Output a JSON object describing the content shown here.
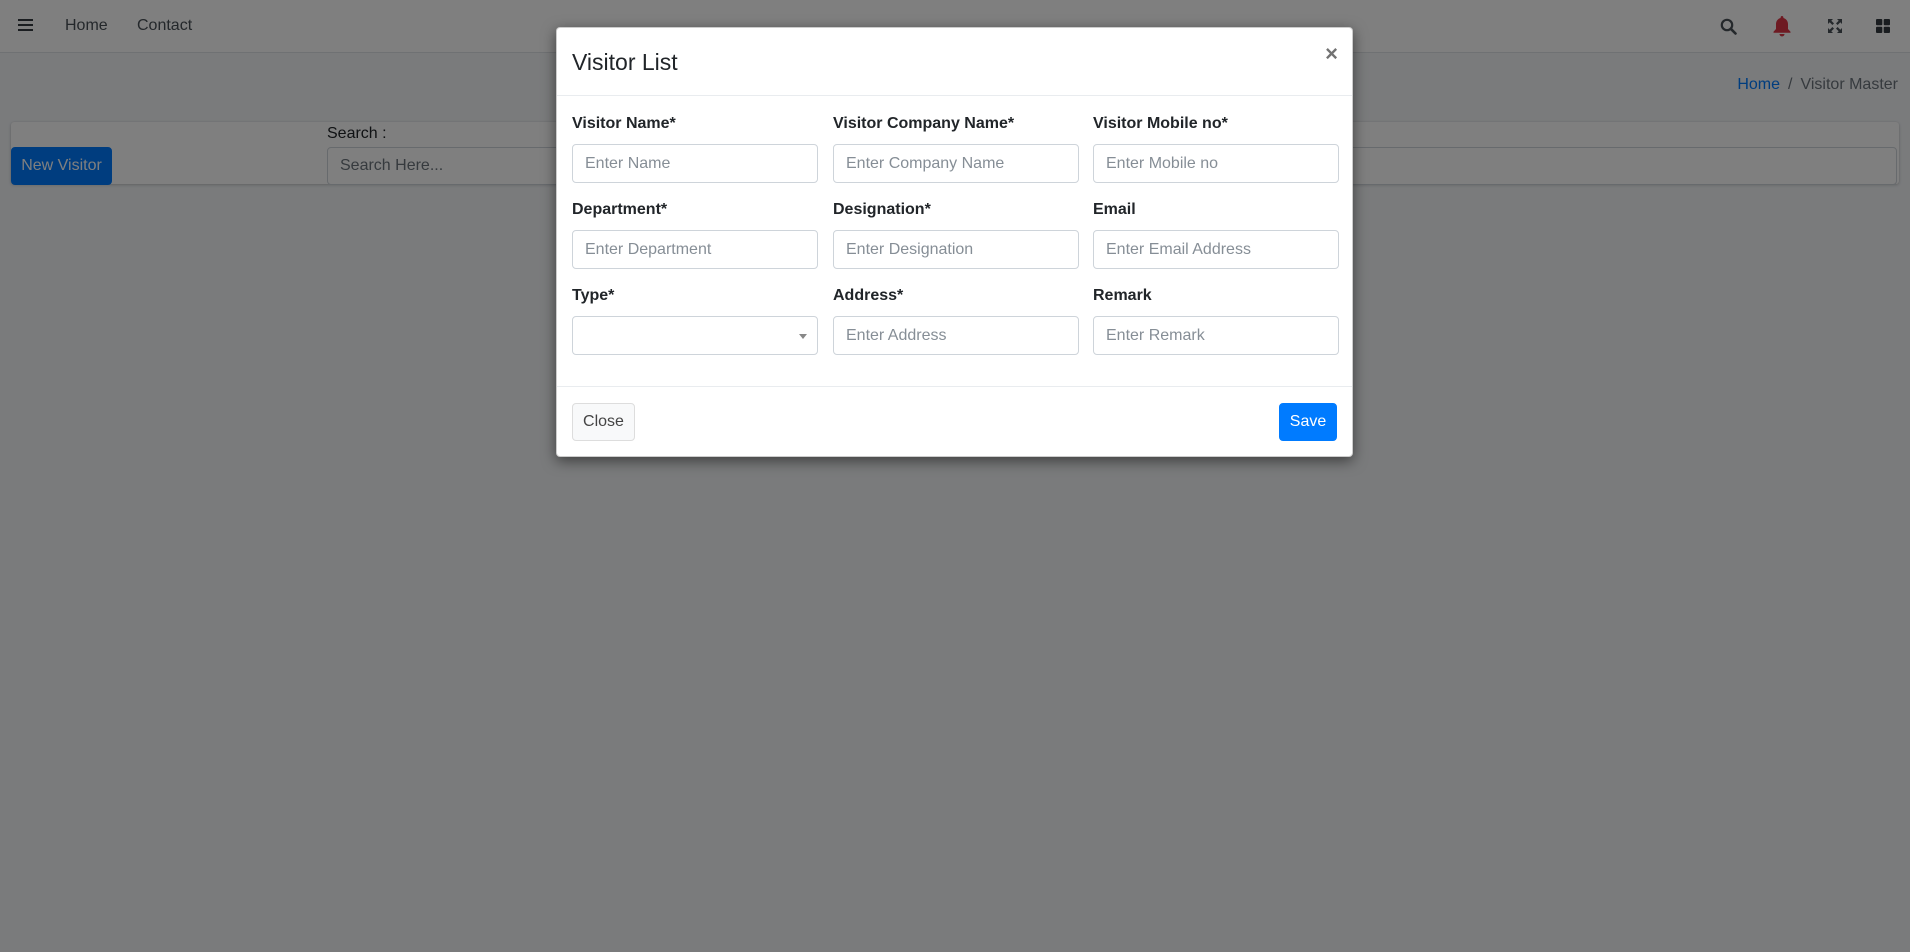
{
  "navbar": {
    "menu_icon": "hamburger-icon",
    "links": [
      "Home",
      "Contact"
    ],
    "icons": [
      "search-icon",
      "bell-icon",
      "expand-icon",
      "grid-icon"
    ],
    "bell_color": "#dc3545"
  },
  "breadcrumb": {
    "home": "Home",
    "separator": "/",
    "current": "Visitor Master"
  },
  "toolbar": {
    "new_visitor_label": "New Visitor",
    "search_label": "Search :",
    "search_placeholder": "Search Here..."
  },
  "modal": {
    "title": "Visitor List",
    "close_symbol": "×",
    "fields": {
      "visitor_name": {
        "label": "Visitor Name*",
        "placeholder": "Enter Name"
      },
      "company_name": {
        "label": "Visitor Company Name*",
        "placeholder": "Enter Company Name"
      },
      "mobile_no": {
        "label": "Visitor Mobile no*",
        "placeholder": "Enter Mobile no"
      },
      "department": {
        "label": "Department*",
        "placeholder": "Enter Department"
      },
      "designation": {
        "label": "Designation*",
        "placeholder": "Enter Designation"
      },
      "email": {
        "label": "Email",
        "placeholder": "Enter Email Address"
      },
      "type": {
        "label": "Type*",
        "value": ""
      },
      "address": {
        "label": "Address*",
        "placeholder": "Enter Address"
      },
      "remark": {
        "label": "Remark",
        "placeholder": "Enter Remark"
      }
    },
    "footer": {
      "close_label": "Close",
      "save_label": "Save"
    }
  },
  "colors": {
    "primary": "#007bff",
    "backdrop": "rgba(0,0,0,0.5)"
  }
}
